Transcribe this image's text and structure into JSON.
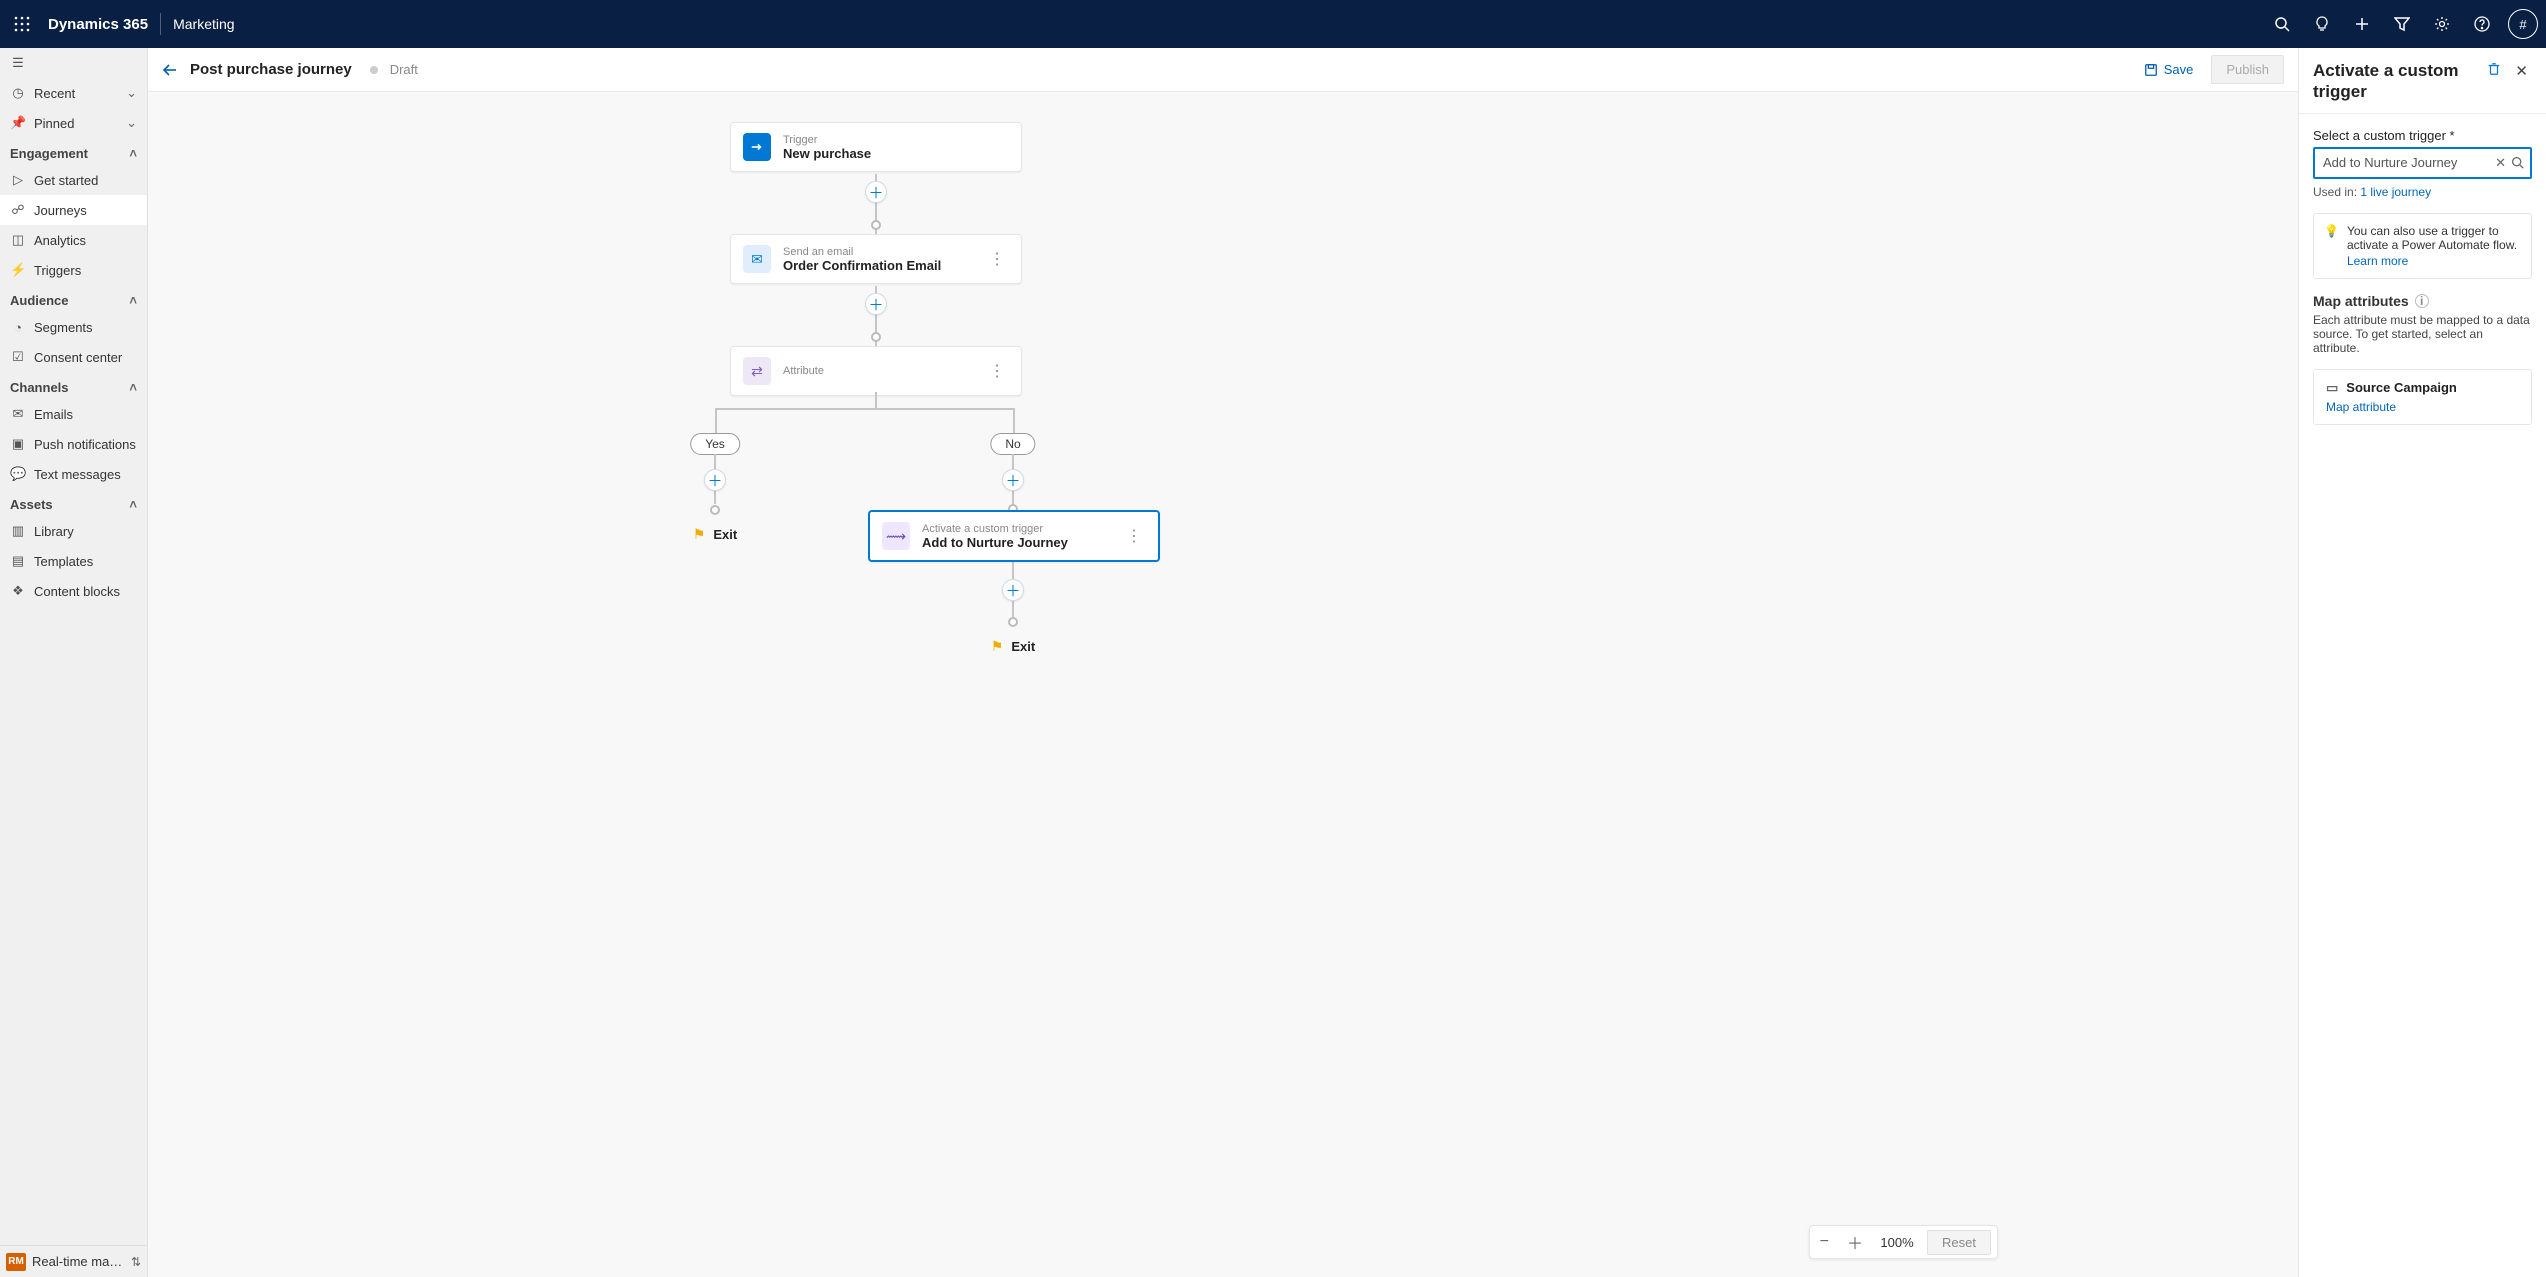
{
  "topbar": {
    "brand": "Dynamics 365",
    "app": "Marketing",
    "avatar": "#"
  },
  "sidebar": {
    "recent": "Recent",
    "pinned": "Pinned",
    "sections": {
      "engagement": {
        "title": "Engagement",
        "items": [
          "Get started",
          "Journeys",
          "Analytics",
          "Triggers"
        ]
      },
      "audience": {
        "title": "Audience",
        "items": [
          "Segments",
          "Consent center"
        ]
      },
      "channels": {
        "title": "Channels",
        "items": [
          "Emails",
          "Push notifications",
          "Text messages"
        ]
      },
      "assets": {
        "title": "Assets",
        "items": [
          "Library",
          "Templates",
          "Content blocks"
        ]
      }
    },
    "footer_badge": "RM",
    "footer_text": "Real-time marketi..."
  },
  "page": {
    "title": "Post purchase journey",
    "status": "Draft",
    "save": "Save",
    "publish": "Publish"
  },
  "canvas": {
    "trigger": {
      "sub": "Trigger",
      "title": "New purchase"
    },
    "email": {
      "sub": "Send an email",
      "title": "Order Confirmation Email"
    },
    "attr": {
      "title": "Attribute"
    },
    "yes": "Yes",
    "no": "No",
    "custom": {
      "sub": "Activate a custom trigger",
      "title": "Add to Nurture Journey"
    },
    "exit": "Exit"
  },
  "zoom": {
    "level": "100%",
    "reset": "Reset"
  },
  "panel": {
    "title": "Activate a custom trigger",
    "trigger_label": "Select a custom trigger *",
    "trigger_value": "Add to Nurture Journey",
    "used_in_prefix": "Used in: ",
    "used_in_link": "1 live journey",
    "tip_text": "You can also use a trigger to activate a Power Automate flow.",
    "tip_link": "Learn more",
    "map_header": "Map attributes",
    "map_help": "Each attribute must be mapped to a data source. To get started, select an attribute.",
    "attr_name": "Source Campaign",
    "attr_link": "Map attribute"
  }
}
